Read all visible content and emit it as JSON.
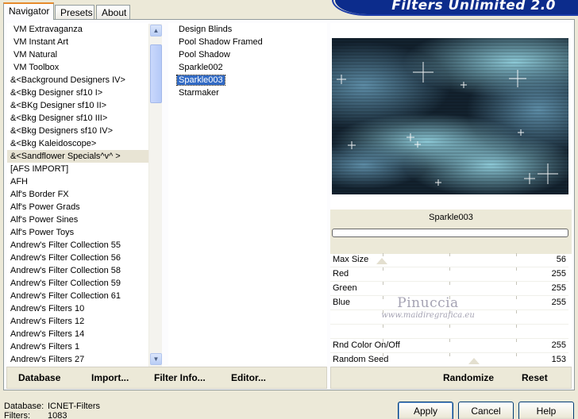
{
  "tabs": [
    {
      "label": "Navigator",
      "active": true
    },
    {
      "label": "Presets",
      "active": false
    },
    {
      "label": "About",
      "active": false
    }
  ],
  "banner": {
    "title": "Filters Unlimited 2.0"
  },
  "categories": [
    {
      "label": "VM Extravaganza",
      "indent": true
    },
    {
      "label": "VM Instant Art",
      "indent": true
    },
    {
      "label": "VM Natural",
      "indent": true
    },
    {
      "label": "VM Toolbox",
      "indent": true
    },
    {
      "label": "&<Background Designers IV>",
      "indent": false
    },
    {
      "label": "&<Bkg Designer sf10 I>",
      "indent": false
    },
    {
      "label": "&<BKg Designer sf10 II>",
      "indent": false
    },
    {
      "label": "&<Bkg Designer sf10 III>",
      "indent": false
    },
    {
      "label": "&<Bkg Designers sf10 IV>",
      "indent": false
    },
    {
      "label": "&<Bkg Kaleidoscope>",
      "indent": false
    },
    {
      "label": "&<Sandflower Specials^v^ >",
      "indent": false,
      "selected": true
    },
    {
      "label": "[AFS IMPORT]",
      "indent": false
    },
    {
      "label": "AFH",
      "indent": false
    },
    {
      "label": "Alf's Border FX",
      "indent": false
    },
    {
      "label": "Alf's Power Grads",
      "indent": false
    },
    {
      "label": "Alf's Power Sines",
      "indent": false
    },
    {
      "label": "Alf's Power Toys",
      "indent": false
    },
    {
      "label": "Andrew's Filter Collection 55",
      "indent": false
    },
    {
      "label": "Andrew's Filter Collection 56",
      "indent": false
    },
    {
      "label": "Andrew's Filter Collection 58",
      "indent": false
    },
    {
      "label": "Andrew's Filter Collection 59",
      "indent": false
    },
    {
      "label": "Andrew's Filter Collection 61",
      "indent": false
    },
    {
      "label": "Andrew's Filters 10",
      "indent": false
    },
    {
      "label": "Andrew's Filters 12",
      "indent": false
    },
    {
      "label": "Andrew's Filters 14",
      "indent": false
    },
    {
      "label": "Andrew's Filters 1",
      "indent": false
    },
    {
      "label": "Andrew's Filters 27",
      "indent": false
    }
  ],
  "filters": [
    {
      "label": "Design Blinds"
    },
    {
      "label": "Pool Shadow Framed"
    },
    {
      "label": "Pool Shadow"
    },
    {
      "label": "Sparkle002"
    },
    {
      "label": "Sparkle003",
      "selected": true
    },
    {
      "label": "Starmaker"
    }
  ],
  "preview": {
    "filter_name": "Sparkle003"
  },
  "params": [
    {
      "label": "Max Size",
      "value": "56"
    },
    {
      "label": "Red",
      "value": "255"
    },
    {
      "label": "Green",
      "value": "255"
    },
    {
      "label": "Blue",
      "value": "255"
    },
    {
      "label": "",
      "value": ""
    },
    {
      "label": "",
      "value": ""
    },
    {
      "label": "Rnd Color On/Off",
      "value": "255"
    },
    {
      "label": "Random Seed",
      "value": "153"
    }
  ],
  "watermark": {
    "name": "Pinuccia",
    "url": "www.maidiregrafica.eu"
  },
  "left_toolbar": {
    "database": "Database",
    "import": "Import...",
    "filter_info": "Filter Info...",
    "editor": "Editor..."
  },
  "right_toolbar": {
    "randomize": "Randomize",
    "reset": "Reset"
  },
  "status": {
    "database_label": "Database:",
    "database_value": "ICNET-Filters",
    "filters_label": "Filters:",
    "filters_value": "1083"
  },
  "buttons": {
    "apply": "Apply",
    "cancel": "Cancel",
    "help": "Help"
  },
  "colors": {
    "dialog_bg": "#ece9d8",
    "selection": "#316ac5",
    "banner": "#0c2c8c",
    "tab_accent": "#e68b2c"
  }
}
